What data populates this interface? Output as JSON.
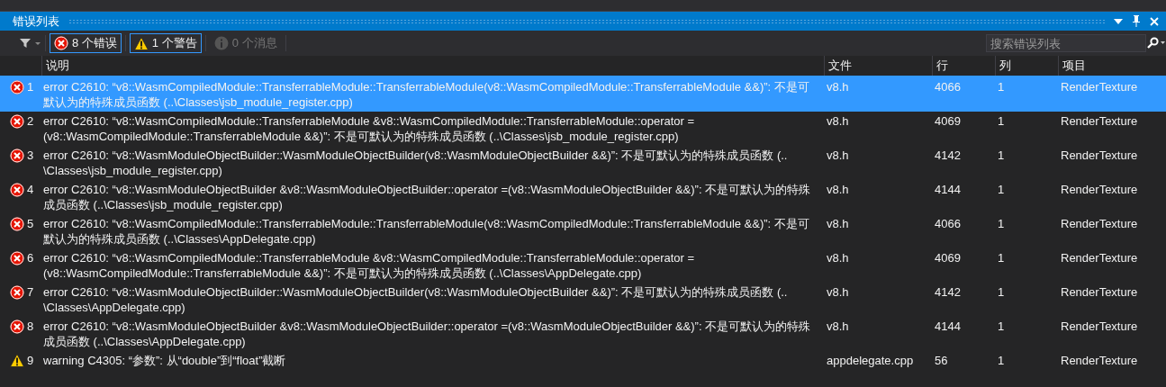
{
  "window": {
    "title": "错误列表"
  },
  "toolbar": {
    "filters": [
      {
        "kind": "error",
        "label": "8 个错误",
        "selected": true
      },
      {
        "kind": "warning",
        "label": "1 个警告",
        "selected": true
      },
      {
        "kind": "message",
        "label": "0 个消息",
        "selected": false
      }
    ],
    "search": {
      "placeholder": "搜索错误列表"
    }
  },
  "table": {
    "columns": [
      "说明",
      "文件",
      "行",
      "列",
      "项目"
    ],
    "rows": [
      {
        "kind": "error",
        "number": "1",
        "selected": true,
        "description": [
          "error C2610: “v8::WasmCompiledModule::TransferrableModule::TransferrableModule(v8::WasmCompiledModule::TransferrableModule &&)”: 不是可",
          "默认为的特殊成员函数 (..\\Classes\\jsb_module_register.cpp)"
        ],
        "file": "v8.h",
        "line": "4066",
        "column": "1",
        "project": "RenderTexture"
      },
      {
        "kind": "error",
        "number": "2",
        "selected": false,
        "description": [
          "error C2610: “v8::WasmCompiledModule::TransferrableModule &v8::WasmCompiledModule::TransferrableModule::operator =",
          "(v8::WasmCompiledModule::TransferrableModule &&)”: 不是可默认为的特殊成员函数 (..\\Classes\\jsb_module_register.cpp)"
        ],
        "file": "v8.h",
        "line": "4069",
        "column": "1",
        "project": "RenderTexture"
      },
      {
        "kind": "error",
        "number": "3",
        "selected": false,
        "description": [
          "error C2610: “v8::WasmModuleObjectBuilder::WasmModuleObjectBuilder(v8::WasmModuleObjectBuilder &&)”: 不是可默认为的特殊成员函数 (..",
          "\\Classes\\jsb_module_register.cpp)"
        ],
        "file": "v8.h",
        "line": "4142",
        "column": "1",
        "project": "RenderTexture"
      },
      {
        "kind": "error",
        "number": "4",
        "selected": false,
        "description": [
          "error C2610: “v8::WasmModuleObjectBuilder &v8::WasmModuleObjectBuilder::operator =(v8::WasmModuleObjectBuilder &&)”: 不是可默认为的特殊",
          "成员函数 (..\\Classes\\jsb_module_register.cpp)"
        ],
        "file": "v8.h",
        "line": "4144",
        "column": "1",
        "project": "RenderTexture"
      },
      {
        "kind": "error",
        "number": "5",
        "selected": false,
        "description": [
          "error C2610: “v8::WasmCompiledModule::TransferrableModule::TransferrableModule(v8::WasmCompiledModule::TransferrableModule &&)”: 不是可",
          "默认为的特殊成员函数 (..\\Classes\\AppDelegate.cpp)"
        ],
        "file": "v8.h",
        "line": "4066",
        "column": "1",
        "project": "RenderTexture"
      },
      {
        "kind": "error",
        "number": "6",
        "selected": false,
        "description": [
          "error C2610: “v8::WasmCompiledModule::TransferrableModule &v8::WasmCompiledModule::TransferrableModule::operator =",
          "(v8::WasmCompiledModule::TransferrableModule &&)”: 不是可默认为的特殊成员函数 (..\\Classes\\AppDelegate.cpp)"
        ],
        "file": "v8.h",
        "line": "4069",
        "column": "1",
        "project": "RenderTexture"
      },
      {
        "kind": "error",
        "number": "7",
        "selected": false,
        "description": [
          "error C2610: “v8::WasmModuleObjectBuilder::WasmModuleObjectBuilder(v8::WasmModuleObjectBuilder &&)”: 不是可默认为的特殊成员函数 (..",
          "\\Classes\\AppDelegate.cpp)"
        ],
        "file": "v8.h",
        "line": "4142",
        "column": "1",
        "project": "RenderTexture"
      },
      {
        "kind": "error",
        "number": "8",
        "selected": false,
        "description": [
          "error C2610: “v8::WasmModuleObjectBuilder &v8::WasmModuleObjectBuilder::operator =(v8::WasmModuleObjectBuilder &&)”: 不是可默认为的特殊",
          "成员函数 (..\\Classes\\AppDelegate.cpp)"
        ],
        "file": "v8.h",
        "line": "4144",
        "column": "1",
        "project": "RenderTexture"
      },
      {
        "kind": "warning",
        "number": "9",
        "selected": false,
        "description": [
          "warning C4305: “参数”: 从“double”到“float”截断"
        ],
        "file": "appdelegate.cpp",
        "line": "56",
        "column": "1",
        "project": "RenderTexture"
      }
    ]
  }
}
